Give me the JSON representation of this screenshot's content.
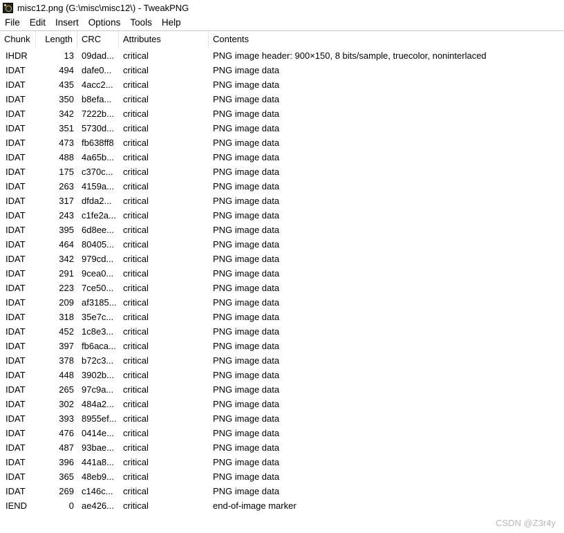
{
  "window": {
    "title": "misc12.png (G:\\misc\\misc12\\) - TweakPNG"
  },
  "menu": [
    "File",
    "Edit",
    "Insert",
    "Options",
    "Tools",
    "Help"
  ],
  "table": {
    "headers": {
      "chunk": "Chunk",
      "length": "Length",
      "crc": "CRC",
      "attributes": "Attributes",
      "contents": "Contents"
    },
    "rows": [
      {
        "chunk": "IHDR",
        "length": "13",
        "crc": "09dad...",
        "attr": "critical",
        "contents": "PNG image header: 900×150, 8 bits/sample, truecolor, noninterlaced"
      },
      {
        "chunk": "IDAT",
        "length": "494",
        "crc": "dafe0...",
        "attr": "critical",
        "contents": "PNG image data"
      },
      {
        "chunk": "IDAT",
        "length": "435",
        "crc": "4acc2...",
        "attr": "critical",
        "contents": "PNG image data"
      },
      {
        "chunk": "IDAT",
        "length": "350",
        "crc": "b8efa...",
        "attr": "critical",
        "contents": "PNG image data"
      },
      {
        "chunk": "IDAT",
        "length": "342",
        "crc": "7222b...",
        "attr": "critical",
        "contents": "PNG image data"
      },
      {
        "chunk": "IDAT",
        "length": "351",
        "crc": "5730d...",
        "attr": "critical",
        "contents": "PNG image data"
      },
      {
        "chunk": "IDAT",
        "length": "473",
        "crc": "fb638ff8",
        "attr": "critical",
        "contents": "PNG image data"
      },
      {
        "chunk": "IDAT",
        "length": "488",
        "crc": "4a65b...",
        "attr": "critical",
        "contents": "PNG image data"
      },
      {
        "chunk": "IDAT",
        "length": "175",
        "crc": "c370c...",
        "attr": "critical",
        "contents": "PNG image data"
      },
      {
        "chunk": "IDAT",
        "length": "263",
        "crc": "4159a...",
        "attr": "critical",
        "contents": "PNG image data"
      },
      {
        "chunk": "IDAT",
        "length": "317",
        "crc": "dfda2...",
        "attr": "critical",
        "contents": "PNG image data"
      },
      {
        "chunk": "IDAT",
        "length": "243",
        "crc": "c1fe2a...",
        "attr": "critical",
        "contents": "PNG image data"
      },
      {
        "chunk": "IDAT",
        "length": "395",
        "crc": "6d8ee...",
        "attr": "critical",
        "contents": "PNG image data"
      },
      {
        "chunk": "IDAT",
        "length": "464",
        "crc": "80405...",
        "attr": "critical",
        "contents": "PNG image data"
      },
      {
        "chunk": "IDAT",
        "length": "342",
        "crc": "979cd...",
        "attr": "critical",
        "contents": "PNG image data"
      },
      {
        "chunk": "IDAT",
        "length": "291",
        "crc": "9cea0...",
        "attr": "critical",
        "contents": "PNG image data"
      },
      {
        "chunk": "IDAT",
        "length": "223",
        "crc": "7ce50...",
        "attr": "critical",
        "contents": "PNG image data"
      },
      {
        "chunk": "IDAT",
        "length": "209",
        "crc": "af3185...",
        "attr": "critical",
        "contents": "PNG image data"
      },
      {
        "chunk": "IDAT",
        "length": "318",
        "crc": "35e7c...",
        "attr": "critical",
        "contents": "PNG image data"
      },
      {
        "chunk": "IDAT",
        "length": "452",
        "crc": "1c8e3...",
        "attr": "critical",
        "contents": "PNG image data"
      },
      {
        "chunk": "IDAT",
        "length": "397",
        "crc": "fb6aca...",
        "attr": "critical",
        "contents": "PNG image data"
      },
      {
        "chunk": "IDAT",
        "length": "378",
        "crc": "b72c3...",
        "attr": "critical",
        "contents": "PNG image data"
      },
      {
        "chunk": "IDAT",
        "length": "448",
        "crc": "3902b...",
        "attr": "critical",
        "contents": "PNG image data"
      },
      {
        "chunk": "IDAT",
        "length": "265",
        "crc": "97c9a...",
        "attr": "critical",
        "contents": "PNG image data"
      },
      {
        "chunk": "IDAT",
        "length": "302",
        "crc": "484a2...",
        "attr": "critical",
        "contents": "PNG image data"
      },
      {
        "chunk": "IDAT",
        "length": "393",
        "crc": "8955ef...",
        "attr": "critical",
        "contents": "PNG image data"
      },
      {
        "chunk": "IDAT",
        "length": "476",
        "crc": "0414e...",
        "attr": "critical",
        "contents": "PNG image data"
      },
      {
        "chunk": "IDAT",
        "length": "487",
        "crc": "93bae...",
        "attr": "critical",
        "contents": "PNG image data"
      },
      {
        "chunk": "IDAT",
        "length": "396",
        "crc": "441a8...",
        "attr": "critical",
        "contents": "PNG image data"
      },
      {
        "chunk": "IDAT",
        "length": "365",
        "crc": "48eb9...",
        "attr": "critical",
        "contents": "PNG image data"
      },
      {
        "chunk": "IDAT",
        "length": "269",
        "crc": "c146c...",
        "attr": "critical",
        "contents": "PNG image data"
      },
      {
        "chunk": "IEND",
        "length": "0",
        "crc": "ae426...",
        "attr": "critical",
        "contents": "end-of-image marker"
      }
    ]
  },
  "watermark": "CSDN @Z3r4y"
}
